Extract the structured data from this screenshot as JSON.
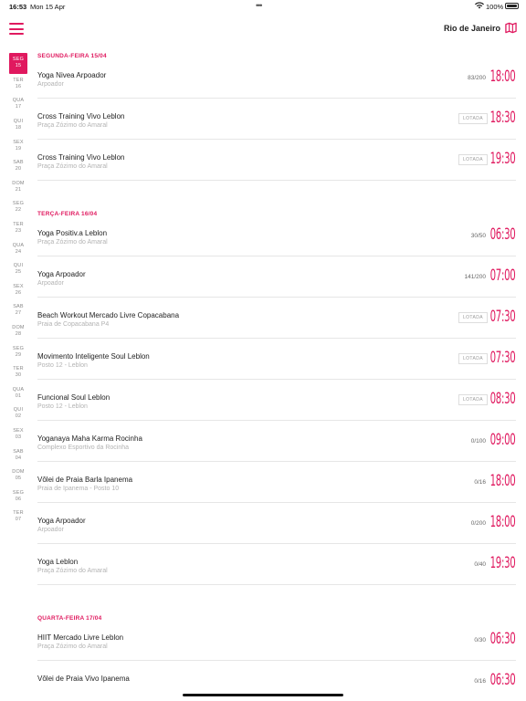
{
  "status_bar": {
    "time": "16:53",
    "date": "Mon 15 Apr",
    "battery": "100%"
  },
  "header": {
    "city": "Rio de Janeiro",
    "menu_icon": "hamburger-icon",
    "map_icon": "map-icon"
  },
  "colors": {
    "accent": "#e0195f"
  },
  "date_rail": [
    {
      "day": "SEG",
      "num": "15",
      "active": true
    },
    {
      "day": "TER",
      "num": "16"
    },
    {
      "day": "QUA",
      "num": "17"
    },
    {
      "day": "QUI",
      "num": "18"
    },
    {
      "day": "SEX",
      "num": "19"
    },
    {
      "day": "SAB",
      "num": "20"
    },
    {
      "day": "DOM",
      "num": "21"
    },
    {
      "day": "SEG",
      "num": "22"
    },
    {
      "day": "TER",
      "num": "23"
    },
    {
      "day": "QUA",
      "num": "24"
    },
    {
      "day": "QUI",
      "num": "25"
    },
    {
      "day": "SEX",
      "num": "26"
    },
    {
      "day": "SAB",
      "num": "27"
    },
    {
      "day": "DOM",
      "num": "28"
    },
    {
      "day": "SEG",
      "num": "29"
    },
    {
      "day": "TER",
      "num": "30"
    },
    {
      "day": "QUA",
      "num": "01"
    },
    {
      "day": "QUI",
      "num": "02"
    },
    {
      "day": "SEX",
      "num": "03"
    },
    {
      "day": "SAB",
      "num": "04"
    },
    {
      "day": "DOM",
      "num": "05"
    },
    {
      "day": "SEG",
      "num": "06"
    },
    {
      "day": "TER",
      "num": "07"
    }
  ],
  "schedule": [
    {
      "header": "SEGUNDA-FEIRA 15/04",
      "classes": [
        {
          "name": "Yoga Nivea Arpoador",
          "location": "Arpoador",
          "count": "83/200",
          "time": "18:00"
        },
        {
          "name": "Cross Training Vivo Leblon",
          "location": "Praça Zózimo do Amaral",
          "full": "LOTADA",
          "time": "18:30"
        },
        {
          "name": "Cross Training Vivo Leblon",
          "location": "Praça Zózimo do Amaral",
          "full": "LOTADA",
          "time": "19:30"
        }
      ]
    },
    {
      "header": "TERÇA-FEIRA 16/04",
      "classes": [
        {
          "name": "Yoga Positiv.a Leblon",
          "location": "Praça Zózimo do Amaral",
          "count": "30/50",
          "time": "06:30"
        },
        {
          "name": "Yoga Arpoador",
          "location": "Arpoador",
          "count": "141/200",
          "time": "07:00"
        },
        {
          "name": "Beach Workout Mercado Livre Copacabana",
          "location": "Praia de Copacabana P4",
          "full": "LOTADA",
          "time": "07:30"
        },
        {
          "name": "Movimento Inteligente Soul Leblon",
          "location": "Posto 12 - Leblon",
          "full": "LOTADA",
          "time": "07:30"
        },
        {
          "name": "Funcional Soul Leblon",
          "location": "Posto 12 - Leblon",
          "full": "LOTADA",
          "time": "08:30"
        },
        {
          "name": "Yoganaya Maha Karma Rocinha",
          "location": "Complexo Esportivo da Rocinha",
          "count": "0/100",
          "time": "09:00"
        },
        {
          "name": "Vôlei de Praia Barla Ipanema",
          "location": "Praia de Ipanema - Posto 10",
          "count": "0/16",
          "time": "18:00"
        },
        {
          "name": "Yoga Arpoador",
          "location": "Arpoador",
          "count": "0/200",
          "time": "18:00"
        },
        {
          "name": "Yoga Leblon",
          "location": "Praça Zózimo do Amaral",
          "count": "0/40",
          "time": "19:30"
        }
      ]
    },
    {
      "header": "QUARTA-FEIRA 17/04",
      "classes": [
        {
          "name": "HIIT Mercado Livre Leblon",
          "location": "Praça Zózimo do Amaral",
          "count": "0/30",
          "time": "06:30"
        },
        {
          "name": "Vôlei de Praia Vivo Ipanema",
          "location": "",
          "count": "0/16",
          "time": "06:30"
        }
      ]
    }
  ]
}
